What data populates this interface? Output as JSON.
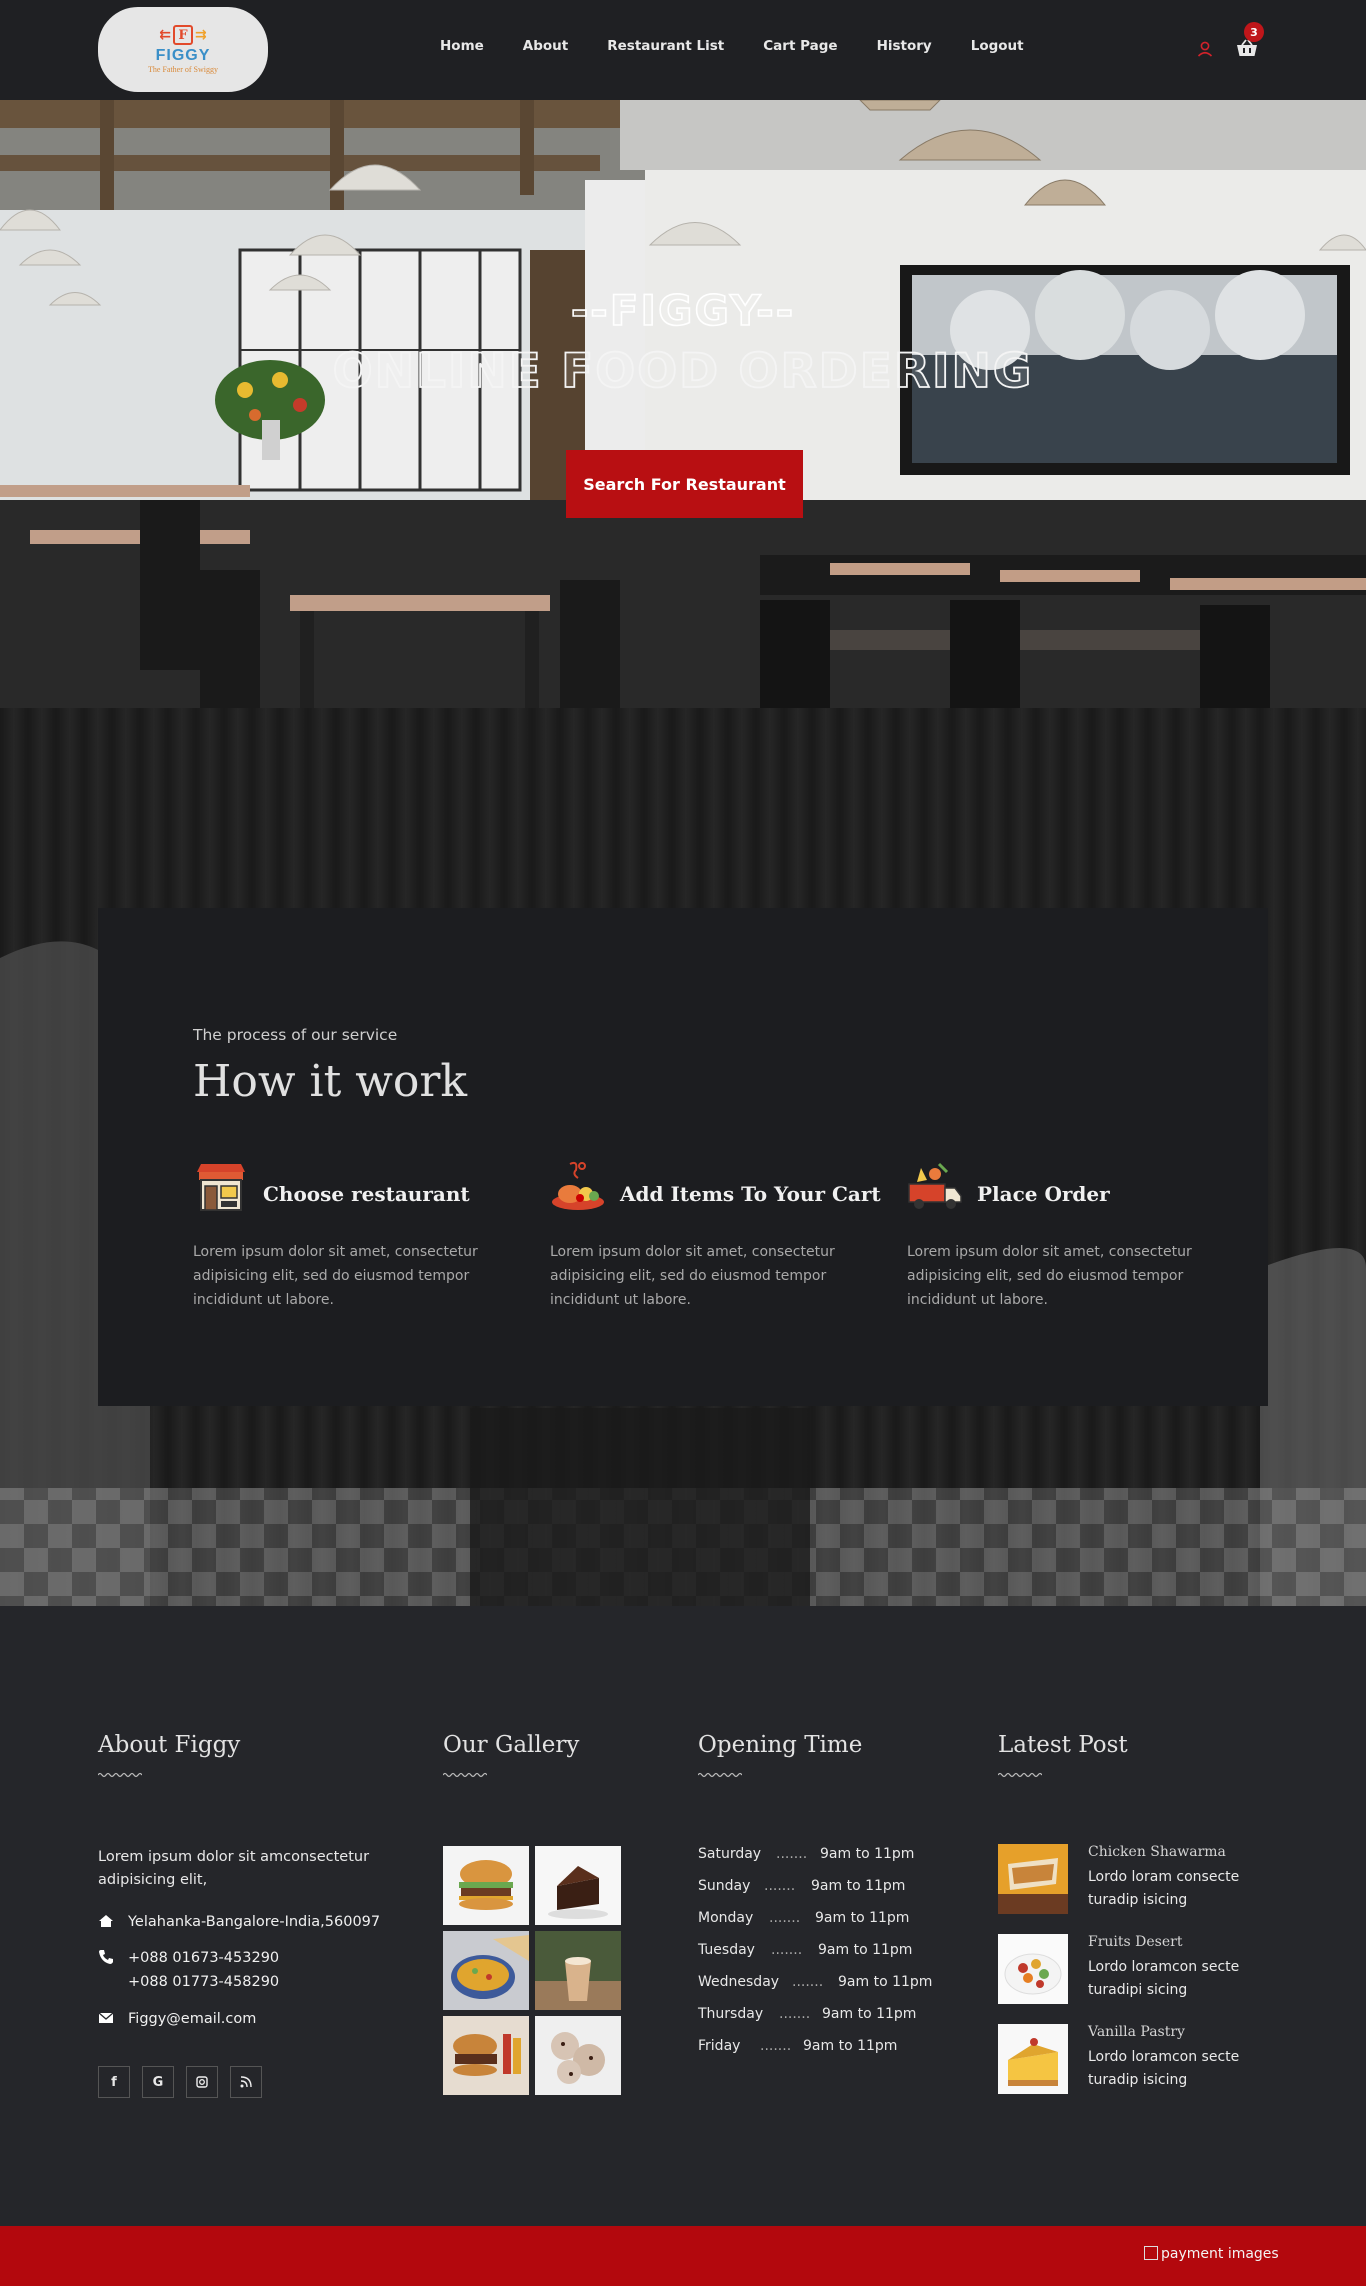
{
  "nav": {
    "logo_text": "FIGGY",
    "logo_tagline": "The Father of Swiggy",
    "logo_letter": "F",
    "links": [
      "Home",
      "About",
      "Restaurant List",
      "Cart Page",
      "History",
      "Logout"
    ],
    "cart_count": "3",
    "icons": [
      "user-icon",
      "cart-icon"
    ]
  },
  "hero": {
    "title": "--FIGGY--",
    "subtitle": "ONLINE FOOD ORDERING",
    "button": "Search For Restaurant"
  },
  "how": {
    "kicker": "The process of our service",
    "title": "How it work",
    "steps": [
      {
        "title": "Choose restaurant",
        "text": "Lorem ipsum dolor sit amet, consectetur adipisicing elit, sed do eiusmod tempor incididunt ut labore.",
        "icon": "restaurant-icon"
      },
      {
        "title": "Add Items To Your Cart",
        "text": "Lorem ipsum dolor sit amet, consectetur adipisicing elit, sed do eiusmod tempor incididunt ut labore.",
        "icon": "food-plate-icon"
      },
      {
        "title": "Place Order",
        "text": "Lorem ipsum dolor sit amet, consectetur adipisicing elit, sed do eiusmod tempor incididunt ut labore.",
        "icon": "delivery-truck-icon"
      }
    ]
  },
  "footer": {
    "about": {
      "title": "About Figgy",
      "text": "Lorem ipsum dolor sit amconsectetur adipisicing elit,",
      "address": "Yelahanka-Bangalore-India,560097",
      "phone1": "+088 01673-453290",
      "phone2": "+088 01773-458290",
      "email": "Figgy@email.com",
      "social": [
        "f",
        "G",
        "instagram-icon",
        "rss-icon"
      ]
    },
    "gallery": {
      "title": "Our Gallery",
      "images": [
        "burger",
        "chocolate-cake",
        "biryani",
        "milkshake",
        "burger-with-sauces",
        "cookies"
      ]
    },
    "hours": {
      "title": "Opening Time",
      "rows": [
        {
          "day": "Saturday",
          "dots": ".......",
          "time": "9am to 11pm"
        },
        {
          "day": "Sunday",
          "dots": ".......",
          "time": "9am to 11pm"
        },
        {
          "day": "Monday",
          "dots": ".......",
          "time": "9am to 11pm"
        },
        {
          "day": "Tuesday",
          "dots": ".......",
          "time": "9am to 11pm"
        },
        {
          "day": "Wednesday",
          "dots": ".......",
          "time": "9am to 11pm"
        },
        {
          "day": "Thursday",
          "dots": ".......",
          "time": "9am to 11pm"
        },
        {
          "day": "Friday",
          "dots": ".......",
          "time": "9am to 11pm"
        }
      ]
    },
    "posts": {
      "title": "Latest Post",
      "items": [
        {
          "title": "Chicken Shawarma",
          "text": "Lordo loram consecte turadip isicing"
        },
        {
          "title": "Fruits Desert",
          "text": "Lordo loramcon secte turadipi sicing"
        },
        {
          "title": "Vanilla Pastry",
          "text": "Lordo loramcon secte turadip isicing"
        }
      ]
    }
  },
  "bottom": {
    "payment_alt": "payment images"
  },
  "colors": {
    "accent": "#b80f12",
    "nav_bg": "#1f2023",
    "footer_bg": "#25262a",
    "card_bg": "#1c1d20"
  }
}
